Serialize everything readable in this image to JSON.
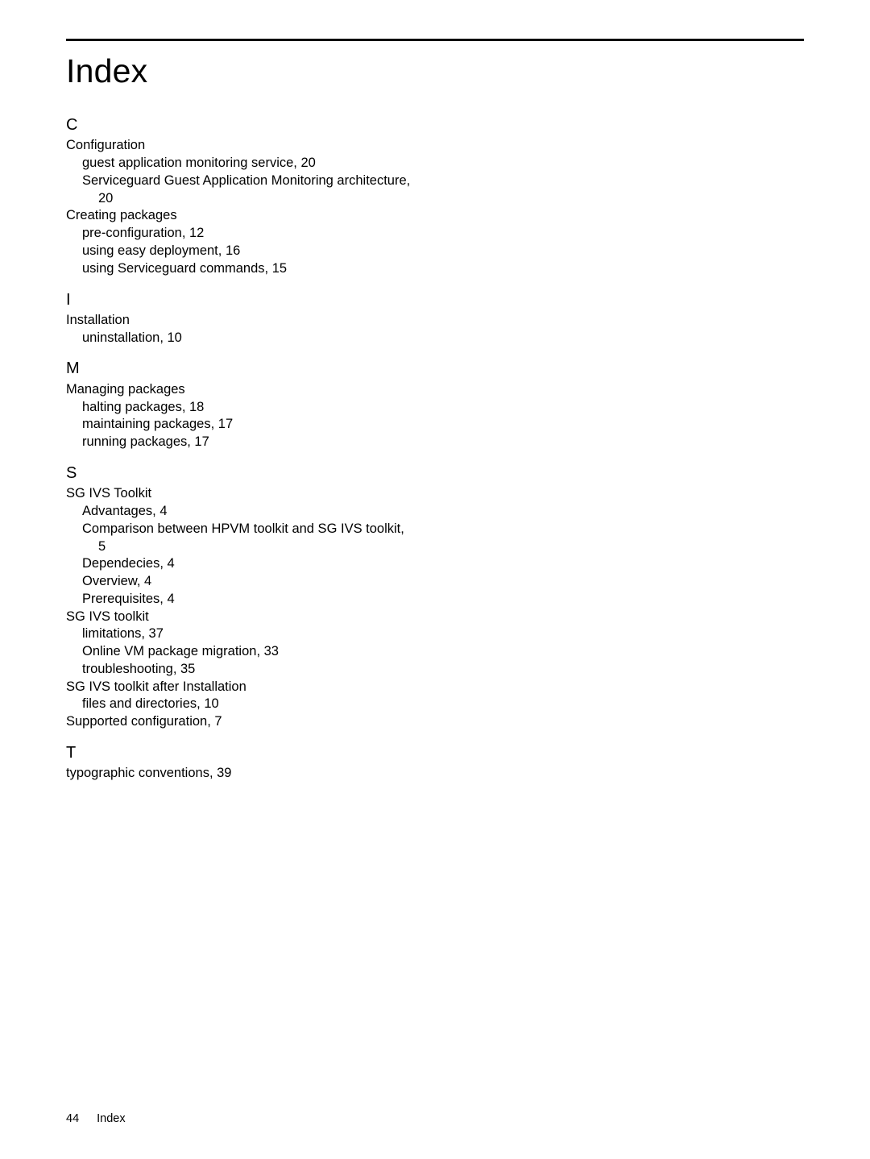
{
  "title": "Index",
  "sections": {
    "C": {
      "letter": "C",
      "entries": [
        {
          "level": 0,
          "text": "Configuration"
        },
        {
          "level": 1,
          "text": "guest application monitoring service, 20"
        },
        {
          "level": 1,
          "text": "Serviceguard Guest Application Monitoring architecture,"
        },
        {
          "level": 2,
          "text": "20"
        },
        {
          "level": 0,
          "text": "Creating packages"
        },
        {
          "level": 1,
          "text": "pre-configuration, 12"
        },
        {
          "level": 1,
          "text": "using easy deployment, 16"
        },
        {
          "level": 1,
          "text": "using Serviceguard commands, 15"
        }
      ]
    },
    "I": {
      "letter": "I",
      "entries": [
        {
          "level": 0,
          "text": "Installation"
        },
        {
          "level": 1,
          "text": "uninstallation, 10"
        }
      ]
    },
    "M": {
      "letter": "M",
      "entries": [
        {
          "level": 0,
          "text": "Managing packages"
        },
        {
          "level": 1,
          "text": "halting packages, 18"
        },
        {
          "level": 1,
          "text": "maintaining packages, 17"
        },
        {
          "level": 1,
          "text": "running packages, 17"
        }
      ]
    },
    "S": {
      "letter": "S",
      "entries": [
        {
          "level": 0,
          "text": "SG IVS Toolkit"
        },
        {
          "level": 1,
          "text": "Advantages, 4"
        },
        {
          "level": 1,
          "text": "Comparison between HPVM toolkit and SG IVS toolkit,"
        },
        {
          "level": 2,
          "text": "5"
        },
        {
          "level": 1,
          "text": "Dependecies, 4"
        },
        {
          "level": 1,
          "text": "Overview, 4"
        },
        {
          "level": 1,
          "text": "Prerequisites, 4"
        },
        {
          "level": 0,
          "text": "SG IVS toolkit"
        },
        {
          "level": 1,
          "text": "limitations, 37"
        },
        {
          "level": 1,
          "text": "Online VM package migration, 33"
        },
        {
          "level": 1,
          "text": "troubleshooting, 35"
        },
        {
          "level": 0,
          "text": "SG IVS toolkit after Installation"
        },
        {
          "level": 1,
          "text": "files and directories, 10"
        },
        {
          "level": 0,
          "text": "Supported configuration, 7"
        }
      ]
    },
    "T": {
      "letter": "T",
      "entries": [
        {
          "level": 0,
          "text": "typographic conventions, 39"
        }
      ]
    }
  },
  "footer": {
    "page_number": "44",
    "section_title": "Index"
  }
}
